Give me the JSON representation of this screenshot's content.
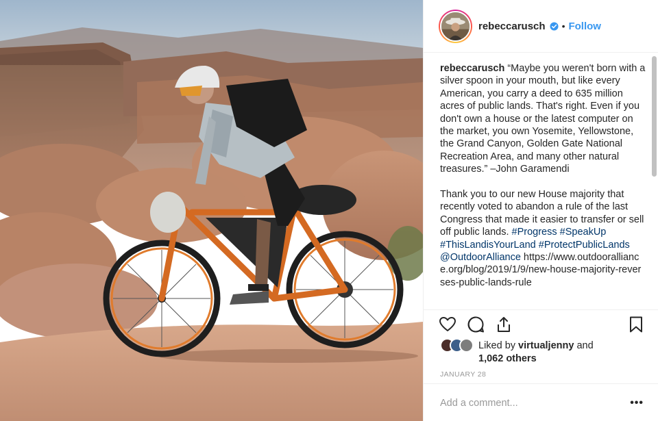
{
  "photo": {
    "alt_subject": "mountain biker on desert slickrock"
  },
  "header": {
    "username": "rebeccarusch",
    "verified_icon": "verified-badge-icon",
    "separator": "•",
    "follow_label": "Follow"
  },
  "caption": {
    "username": "rebeccarusch",
    "paragraph1": "“Maybe you weren't born with a silver spoon in your mouth, but like every American, you carry a deed to 635 million acres of public lands. That's right. Even if you don't own a house or the latest computer on the market, you own Yosemite, Yellowstone, the Grand Canyon, Golden Gate National Recreation Area, and many other natural treasures.” –John Garamendi",
    "paragraph2_text": "Thank you to our  new House majority that recently voted to abandon a rule of the last Congress that made it easier to transfer or sell off public lands.",
    "hashtags": [
      "#Progress",
      "#SpeakUp",
      "#ThisLandisYourLand",
      "#ProtectPublicLands"
    ],
    "mention": "@OutdoorAlliance",
    "url": "https://www.outdooralliance.org/blog/2019/1/9/new-house-majority-reverses-public-lands-rule"
  },
  "actions": {
    "like_icon": "heart-icon",
    "comment_icon": "comment-icon",
    "share_icon": "share-icon",
    "save_icon": "bookmark-icon"
  },
  "likes": {
    "prefix": "Liked by",
    "user": "virtualjenny",
    "conj": "and",
    "others": "1,062 others"
  },
  "date": "JANUARY 28",
  "comment": {
    "placeholder": "Add a comment...",
    "more_label": "•••"
  },
  "colors": {
    "link": "#003569",
    "follow": "#3897f0",
    "verified": "#3897f0",
    "muted": "#999999",
    "border": "#efefef"
  }
}
